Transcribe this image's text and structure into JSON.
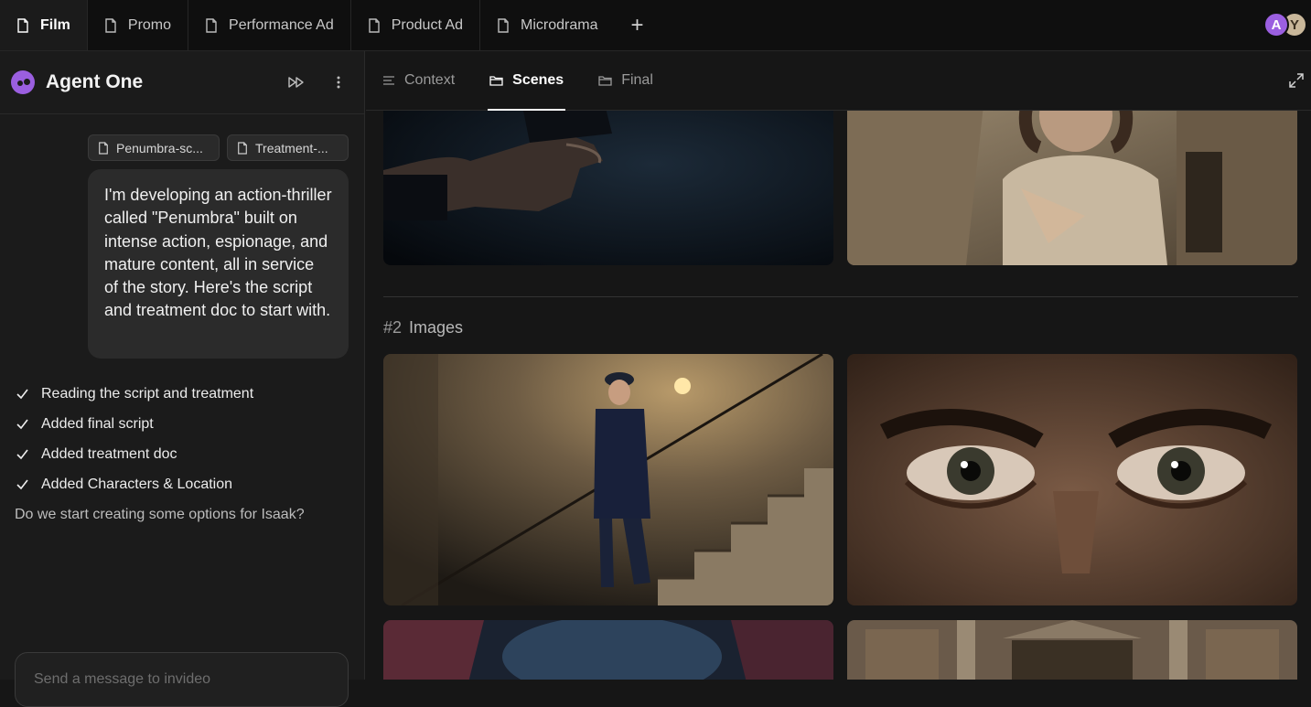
{
  "top_tabs": [
    {
      "label": "Film",
      "active": true
    },
    {
      "label": "Promo"
    },
    {
      "label": "Performance Ad"
    },
    {
      "label": "Product Ad"
    },
    {
      "label": "Microdrama"
    }
  ],
  "add_tab_label": "+",
  "avatars": [
    "A",
    "Y"
  ],
  "agent": {
    "name": "Agent One"
  },
  "attachments": [
    "Penumbra-sc...",
    "Treatment-..."
  ],
  "user_message": "I'm developing an action-thriller called \"Penumbra\" built on intense action, espionage, and mature content, all in service of the story. Here's the script and treatment doc to start with.",
  "checklist": [
    "Reading the script and treatment",
    "Added final script",
    "Added treatment doc",
    "Added Characters & Location"
  ],
  "assistant_question": "Do we start creating some options for Isaak?",
  "composer": {
    "placeholder": "Send a message to invideo"
  },
  "main_tabs": [
    {
      "label": "Context",
      "icon": "lines-icon"
    },
    {
      "label": "Scenes",
      "icon": "folder-icon",
      "active": true
    },
    {
      "label": "Final",
      "icon": "folder-icon"
    }
  ],
  "section": {
    "number": "#2",
    "title": "Images"
  },
  "colors": {
    "accent": "#9b5fe0",
    "background": "#161616",
    "panel": "#1b1b1b"
  }
}
